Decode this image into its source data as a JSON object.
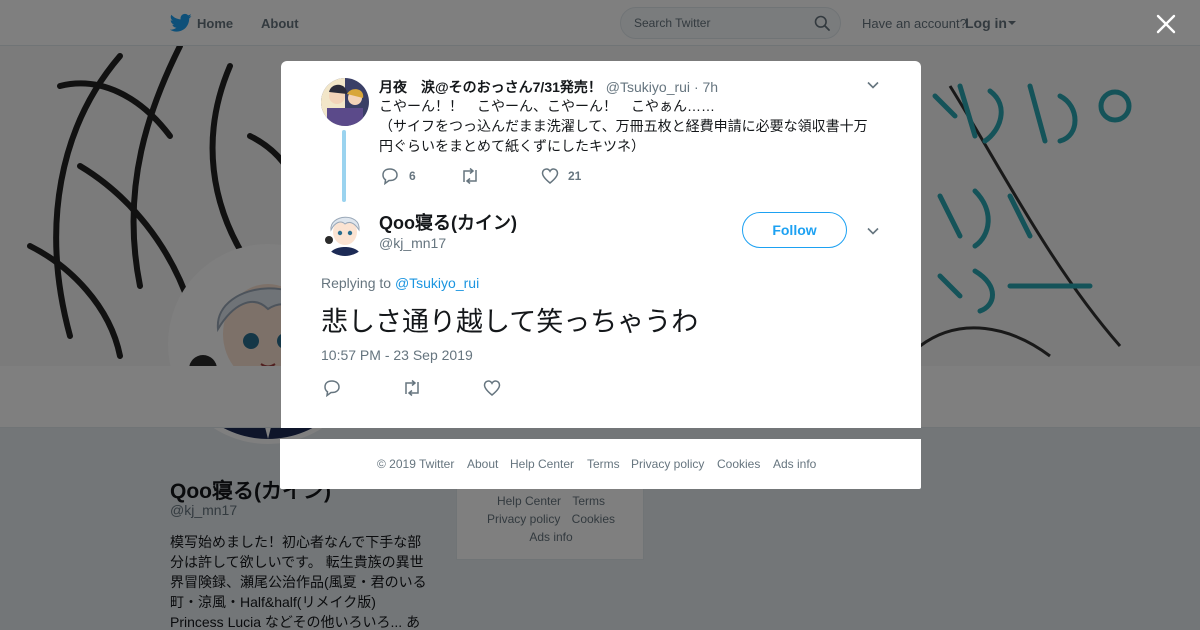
{
  "nav": {
    "home_label": "Home",
    "about_label": "About",
    "search_placeholder": "Search Twitter",
    "have_account": "Have an account?",
    "login_label": "Log in"
  },
  "profile": {
    "name": "Qoo寝る(カイン)",
    "handle": "@kj_mn17",
    "bio": "模写始めました！初心者なんで下手な部分は許して欲しいです。 転生貴族の異世界冒険録、瀬尾公治作品(風夏・君のいる町・涼風・Half&half(リメイク版) Princess Lucia などその他いろいろ... あ"
  },
  "side_footer": {
    "row1": [
      "Help Center",
      "Terms"
    ],
    "row2": [
      "Privacy policy",
      "Cookies"
    ],
    "row3": [
      "Ads info"
    ]
  },
  "parent_tweet": {
    "author": "月夜　涙@そのおっさん7/31発売！",
    "handle": "@Tsukiyo_rui",
    "dot": "·",
    "time": "7h",
    "line1": "こやーん！！　こやーん、こやーん！　こやぁん……",
    "line2": "（サイフをつっ込んだまま洗濯して、万冊五枚と経費申請に必要な領収書十万円ぐらいをまとめて紙くずにしたキツネ）",
    "reply_count": "6",
    "like_count": "21"
  },
  "main_tweet": {
    "name": "Qoo寝る(カイン)",
    "handle": "@kj_mn17",
    "follow_label": "Follow",
    "replying_prefix": "Replying to",
    "replying_handle": "@Tsukiyo_rui",
    "text": "悲しさ通り越して笑っちゃうわ",
    "timestamp": "10:57 PM - 23 Sep 2019"
  },
  "footer": {
    "copyright": "© 2019 Twitter",
    "about": "About",
    "help": "Help Center",
    "terms": "Terms",
    "privacy": "Privacy policy",
    "cookies": "Cookies",
    "ads": "Ads info"
  },
  "colors": {
    "brand": "#1da1f2",
    "link": "#1b95e0",
    "muted": "#66757f",
    "thread_line": "#9ad3ef"
  },
  "icons": [
    "twitter-bird-icon",
    "search-icon",
    "close-icon",
    "reply-icon",
    "retweet-icon",
    "like-icon",
    "chevron-down-icon"
  ]
}
